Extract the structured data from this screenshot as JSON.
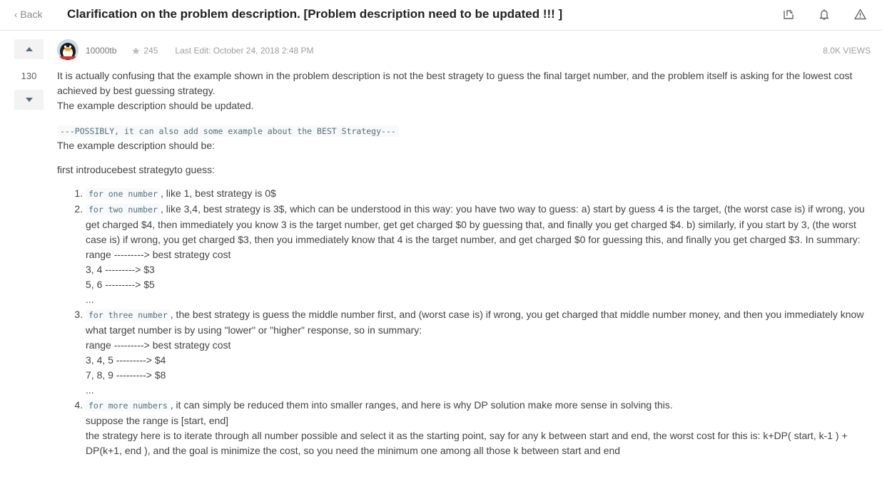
{
  "header": {
    "back_label": "Back",
    "title": "Clarification on the problem description. [Problem description need to be updated !!! ]",
    "icons": [
      "share-icon",
      "bell-icon",
      "report-icon"
    ]
  },
  "post": {
    "votes": "130",
    "author": "10000tb",
    "reputation": "245",
    "last_edit": "Last Edit: October 24, 2018 2:48 PM",
    "views": "8.0K VIEWS",
    "intro_1": "It is actually confusing that the example shown in the problem description is not the best stragety to guess the final target number, and the problem itself is asking for the lowest cost achieved by best guessing strategy.",
    "intro_2": "The example description should be updated.",
    "code_note": "---POSSIBLY, it can also add some example about the BEST Strategy---",
    "should_be": "The example description should be:",
    "first_intro": "first introducebest strategyto guess:",
    "items": [
      {
        "code": "for one number",
        "text": ", like 1, best strategy is 0$",
        "lines": []
      },
      {
        "code": "for two number",
        "text": ", like 3,4, best strategy is 3$, which can be understood in this way: you have two way to guess: a) start by guess 4 is the target, (the worst case is) if wrong, you get charged $4, then immediately you know 3 is the target number, get get charged $0 by guessing that, and finally you get charged $4. b) similarly, if you start by 3, (the worst case is) if wrong, you get charged $3, then you immediately know that 4 is the target number, and get charged $0 for guessing this, and finally you get charged $3. In summary:",
        "lines": [
          "range ---------> best strategy cost",
          "3, 4 ---------> $3",
          "5, 6 ---------> $5",
          "..."
        ]
      },
      {
        "code": "for three number",
        "text": ", the best strategy is guess the middle number first, and (worst case is) if wrong, you get charged that middle number money, and then you immediately know what target number is by using \"lower\" or \"higher\" response, so in summary:",
        "lines": [
          "range ---------> best strategy cost",
          "3, 4, 5 ---------> $4",
          "7, 8, 9 ---------> $8",
          "..."
        ]
      },
      {
        "code": "for more numbers",
        "text": ", it can simply be reduced them into smaller ranges, and here is why DP solution make more sense in solving this.",
        "lines": [
          "suppose the range is [start, end]",
          "the strategy here is to iterate through all number possible and select it as the starting point, say for any k between start and end, the worst cost for this is: k+DP( start, k-1 ) + DP(k+1, end ), and the goal is minimize the cost, so you need the minimum one among all those k between start and end"
        ]
      }
    ]
  }
}
